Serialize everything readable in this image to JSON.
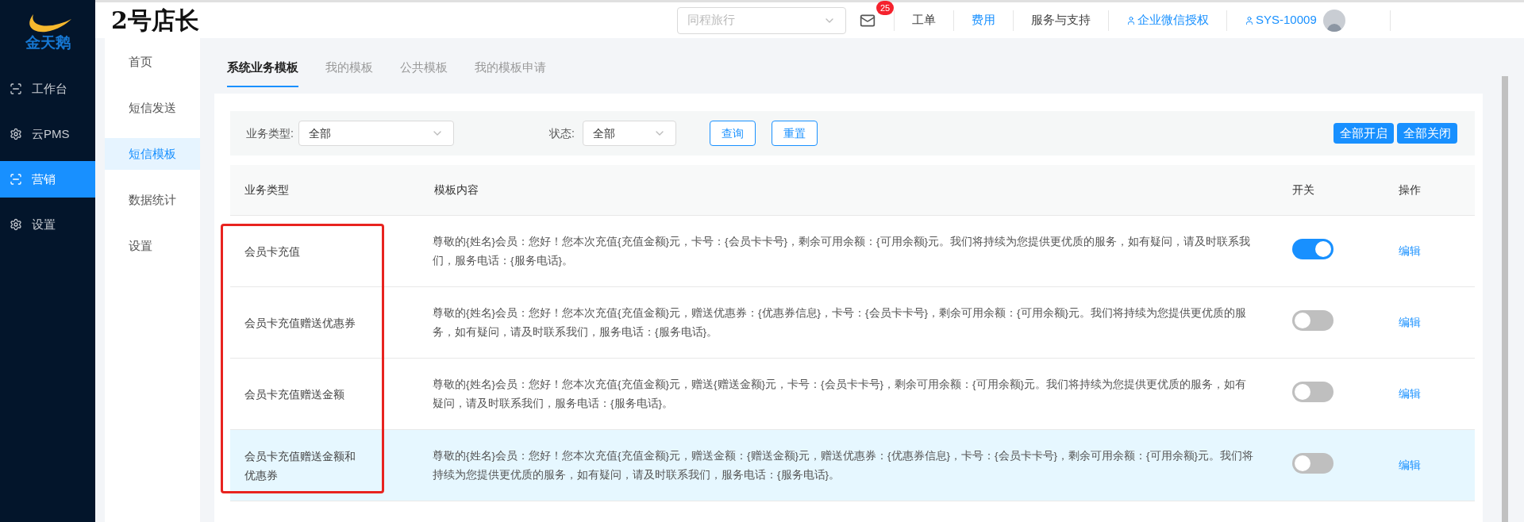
{
  "logo": {
    "text": "金天鹅"
  },
  "app_title": "2号店长",
  "header": {
    "store_select": {
      "placeholder": "同程旅行"
    },
    "mail_badge": "25",
    "links": [
      {
        "label": "工单",
        "kind": "plain"
      },
      {
        "label": "费用",
        "kind": "accent"
      },
      {
        "label": "服务与支持",
        "kind": "plain"
      },
      {
        "label": "企业微信授权",
        "kind": "user"
      },
      {
        "label": "SYS-10009",
        "kind": "user"
      }
    ]
  },
  "nav": [
    {
      "label": "工作台",
      "selected": false
    },
    {
      "label": "云PMS",
      "selected": false
    },
    {
      "label": "营销",
      "selected": true
    },
    {
      "label": "设置",
      "selected": false
    }
  ],
  "sub_nav": [
    {
      "label": "首页",
      "selected": false
    },
    {
      "label": "短信发送",
      "selected": false
    },
    {
      "label": "短信模板",
      "selected": true
    },
    {
      "label": "数据统计",
      "selected": false
    },
    {
      "label": "设置",
      "selected": false
    }
  ],
  "tabs": [
    {
      "label": "系统业务模板",
      "selected": true
    },
    {
      "label": "我的模板",
      "selected": false
    },
    {
      "label": "公共模板",
      "selected": false
    },
    {
      "label": "我的模板申请",
      "selected": false
    }
  ],
  "filters": {
    "type_label": "业务类型:",
    "type_value": "全部",
    "status_label": "状态:",
    "status_value": "全部",
    "query_button": "查询",
    "reset_button": "重置",
    "enable_all_button": "全部开启",
    "disable_all_button": "全部关闭"
  },
  "table": {
    "columns": [
      "业务类型",
      "模板内容",
      "开关",
      "操作"
    ],
    "rows": [
      {
        "type": "会员卡充值",
        "content": "尊敬的{姓名}会员：您好！您本次充值{充值金额}元，卡号：{会员卡卡号}，剩余可用余额：{可用余额}元。我们将持续为您提供更优质的服务，如有疑问，请及时联系我们，服务电话：{服务电话}。",
        "on": true,
        "highlighted": false,
        "action": "编辑"
      },
      {
        "type": "会员卡充值赠送优惠券",
        "content": "尊敬的{姓名}会员：您好！您本次充值{充值金额}元，赠送优惠券：{优惠券信息}，卡号：{会员卡卡号}，剩余可用余额：{可用余额}元。我们将持续为您提供更优质的服务，如有疑问，请及时联系我们，服务电话：{服务电话}。",
        "on": false,
        "highlighted": false,
        "action": "编辑"
      },
      {
        "type": "会员卡充值赠送金额",
        "content": "尊敬的{姓名}会员：您好！您本次充值{充值金额}元，赠送{赠送金额}元，卡号：{会员卡卡号}，剩余可用余额：{可用余额}元。我们将持续为您提供更优质的服务，如有疑问，请及时联系我们，服务电话：{服务电话}。",
        "on": false,
        "highlighted": false,
        "action": "编辑"
      },
      {
        "type": "会员卡充值赠送金额和优惠券",
        "content": "尊敬的{姓名}会员：您好！您本次充值{充值金额}元，赠送金额：{赠送金额}元，赠送优惠券：{优惠券信息}，卡号：{会员卡卡号}，剩余可用余额：{可用余额}元。我们将持续为您提供更优质的服务，如有疑问，请及时联系我们，服务电话：{服务电话}。",
        "on": false,
        "highlighted": true,
        "action": "编辑"
      }
    ]
  }
}
